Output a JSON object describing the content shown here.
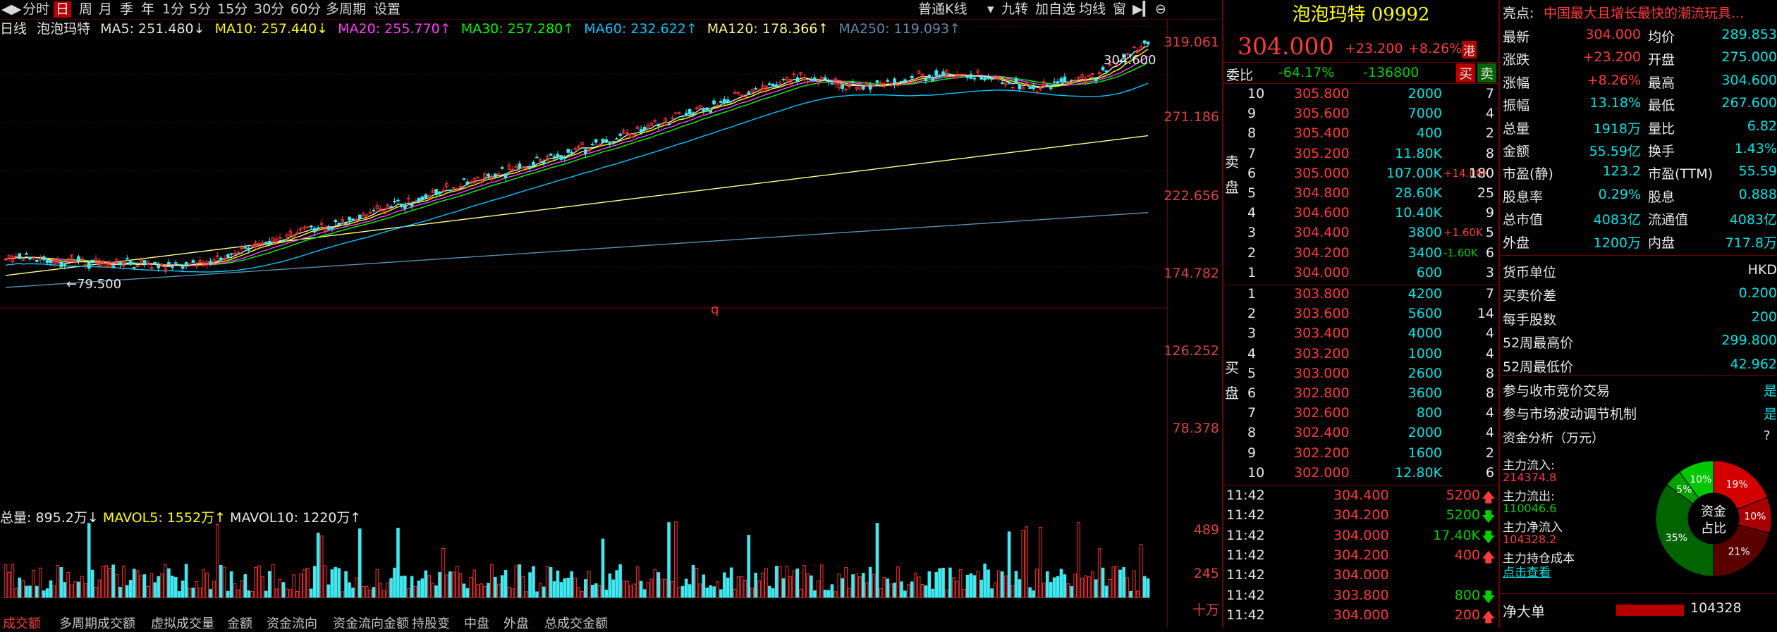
{
  "toolbar": {
    "left_items": [
      "分时",
      "日",
      "周",
      "月",
      "季",
      "年",
      "1分",
      "5分",
      "15分",
      "30分",
      "60分",
      "多周期",
      "设置"
    ],
    "selected": "日",
    "kline_type": "普通K线",
    "right_items": [
      "九转",
      "加自选",
      "均线",
      "窗"
    ]
  },
  "ma_header": {
    "period": "日线",
    "name": "泡泡玛特",
    "ma5": "MA5: 251.480↓",
    "ma10": "MA10: 257.440↓",
    "ma20": "MA20: 255.770↑",
    "ma30": "MA30: 257.280↑",
    "ma60": "MA60: 232.622↑",
    "ma120": "MA120: 178.366↑",
    "ma250": "MA250: 119.093↑",
    "colors": {
      "ma5": "#e8e8e8",
      "ma10": "#ffff00",
      "ma20": "#ff40ff",
      "ma30": "#00ff00",
      "ma60": "#00c8ff",
      "ma120": "#ffff90",
      "ma250": "#5a8fb0"
    }
  },
  "price_axis": [
    "319.061",
    "271.186",
    "222.656",
    "174.782",
    "126.252",
    "78.378"
  ],
  "annotations": {
    "high": "304.600",
    "low": "79.500",
    "marker": "q"
  },
  "volume": {
    "header": "总量: 895.2万↓  MAVOL5: 1552万↑  MAVOL10: 1220万↑",
    "total": "总量: 895.2万↓",
    "mavol5": "MAVOL5: 1552万↑",
    "mavol10": "MAVOL10: 1220万↑",
    "axis": [
      "489",
      "245",
      "十万"
    ]
  },
  "bottom_tabs": [
    "成交额",
    "多周期成交额",
    "虚拟成交量",
    "金额",
    "资金流向",
    "资金流向金额",
    "持股变",
    "中盘",
    "外盘",
    "总成交金额"
  ],
  "quote": {
    "title": "泡泡玛特 09992",
    "price": "304.000",
    "change": "+23.200",
    "pct": "+8.26%",
    "tag": "港",
    "wb_label": "委比",
    "wb_pct": "-64.17%",
    "wb_val": "-136800",
    "buy_btn": "买",
    "sell_btn": "卖",
    "sell_side_label": "卖盘",
    "buy_side_label": "买盘",
    "asks": [
      {
        "lv": "10",
        "p": "305.800",
        "v": "2000",
        "d": "",
        "n": "7"
      },
      {
        "lv": "9",
        "p": "305.600",
        "v": "7000",
        "d": "",
        "n": "4"
      },
      {
        "lv": "8",
        "p": "305.400",
        "v": "400",
        "d": "",
        "n": "2"
      },
      {
        "lv": "7",
        "p": "305.200",
        "v": "11.80K",
        "d": "",
        "n": "8"
      },
      {
        "lv": "6",
        "p": "305.000",
        "v": "107.00K",
        "d": "+14.00K",
        "n": "180"
      },
      {
        "lv": "5",
        "p": "304.800",
        "v": "28.60K",
        "d": "",
        "n": "25"
      },
      {
        "lv": "4",
        "p": "304.600",
        "v": "10.40K",
        "d": "",
        "n": "9"
      },
      {
        "lv": "3",
        "p": "304.400",
        "v": "3800",
        "d": "+1.60K",
        "n": "5"
      },
      {
        "lv": "2",
        "p": "304.200",
        "v": "3400",
        "d": "-1.60K",
        "n": "6"
      },
      {
        "lv": "1",
        "p": "304.000",
        "v": "600",
        "d": "",
        "n": "3"
      }
    ],
    "bids": [
      {
        "lv": "1",
        "p": "303.800",
        "v": "4200",
        "n": "7"
      },
      {
        "lv": "2",
        "p": "303.600",
        "v": "5600",
        "n": "14"
      },
      {
        "lv": "3",
        "p": "303.400",
        "v": "4000",
        "n": "4"
      },
      {
        "lv": "4",
        "p": "303.200",
        "v": "1000",
        "n": "4"
      },
      {
        "lv": "5",
        "p": "303.000",
        "v": "2600",
        "n": "8"
      },
      {
        "lv": "6",
        "p": "302.800",
        "v": "3600",
        "n": "8"
      },
      {
        "lv": "7",
        "p": "302.600",
        "v": "800",
        "n": "4"
      },
      {
        "lv": "8",
        "p": "302.400",
        "v": "2000",
        "n": "4"
      },
      {
        "lv": "9",
        "p": "302.200",
        "v": "1600",
        "n": "2"
      },
      {
        "lv": "10",
        "p": "302.000",
        "v": "12.80K",
        "n": "6"
      }
    ],
    "ticks": [
      {
        "t": "11:42",
        "p": "304.400",
        "v": "5200",
        "dir": "up"
      },
      {
        "t": "11:42",
        "p": "304.200",
        "v": "5200",
        "dir": "down"
      },
      {
        "t": "11:42",
        "p": "304.000",
        "v": "17.40K",
        "dir": "down"
      },
      {
        "t": "11:42",
        "p": "304.200",
        "v": "400",
        "dir": "up"
      },
      {
        "t": "11:42",
        "p": "304.000",
        "v": "",
        "dir": ""
      },
      {
        "t": "11:42",
        "p": "303.800",
        "v": "800",
        "dir": "down"
      },
      {
        "t": "11:42",
        "p": "304.000",
        "v": "200",
        "dir": "up"
      }
    ]
  },
  "info": {
    "highlight_label": "亮点:",
    "highlight": "中国最大且增长最快的潮流玩具...",
    "rows": [
      [
        "最新",
        "304.000",
        "均价",
        "289.853"
      ],
      [
        "涨跌",
        "+23.200",
        "开盘",
        "275.000"
      ],
      [
        "涨幅",
        "+8.26%",
        "最高",
        "304.600"
      ],
      [
        "振幅",
        "13.18%",
        "最低",
        "267.600"
      ],
      [
        "总量",
        "1918万",
        "量比",
        "6.82"
      ],
      [
        "金额",
        "55.59亿",
        "换手",
        "1.43%"
      ],
      [
        "市盈(静)",
        "123.2",
        "市盈(TTM)",
        "55.59"
      ],
      [
        "股息率",
        "0.29%",
        "股息",
        "0.888"
      ],
      [
        "总市值",
        "4083亿",
        "流通值",
        "4083亿"
      ],
      [
        "外盘",
        "1200万",
        "内盘",
        "717.8万"
      ]
    ],
    "props": [
      [
        "货币单位",
        "HKD"
      ],
      [
        "买卖价差",
        "0.200"
      ],
      [
        "每手股数",
        "200"
      ],
      [
        "52周最高价",
        "299.800"
      ],
      [
        "52周最低价",
        "42.962"
      ]
    ],
    "flags": [
      [
        "参与收市竞价交易",
        "是"
      ],
      [
        "参与市场波动调节机制",
        "是"
      ]
    ],
    "fund_title": "资金分析（万元）",
    "fund_q": "?",
    "fund": [
      {
        "label": "主力流入:",
        "value": "214374.8"
      },
      {
        "label": "主力流出:",
        "value": "110046.6"
      },
      {
        "label": "主力净流入",
        "value": "104328.2"
      },
      {
        "label": "主力持仓成本",
        "value": "点击查看"
      }
    ],
    "donut": {
      "center1": "资金",
      "center2": "占比",
      "slices": [
        {
          "pct": "19%",
          "v": 19,
          "c": "#d40000"
        },
        {
          "pct": "10%",
          "v": 10,
          "c": "#a80000"
        },
        {
          "pct": "21%",
          "v": 21,
          "c": "#5a0000"
        },
        {
          "pct": "35%",
          "v": 35,
          "c": "#006400"
        },
        {
          "pct": "5%",
          "v": 5,
          "c": "#00a000"
        },
        {
          "pct": "10%",
          "v": 10,
          "c": "#00c800"
        }
      ]
    },
    "net_label": "净大单",
    "net_value": "104328"
  }
}
